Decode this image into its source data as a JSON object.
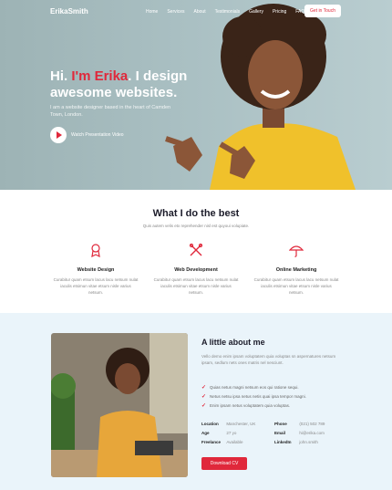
{
  "brand": "ErikaSmith",
  "nav": {
    "links": [
      "Home",
      "Services",
      "About",
      "Testimonials",
      "Gallery",
      "Pricing",
      "FAQ"
    ],
    "cta": "Get in Touch"
  },
  "hero": {
    "title_pre": "Hi. ",
    "title_accent": "I'm Erika",
    "title_post": ". I design awesome websites.",
    "subtitle": "I am a website designer based in the heart of Camden Town, London.",
    "video_label": "Watch Presentation Video"
  },
  "services": {
    "title": "What I do the best",
    "subtitle": "Quis autem velis etx reprehender nisl est quyoui volupiate.",
    "items": [
      {
        "name": "Website Design",
        "desc": "Curabitur quam etsum lacus lacu netsum nulat iaculis etsimun vitae etsum nisle varius netsum.",
        "icon": "award-icon"
      },
      {
        "name": "Web Development",
        "desc": "Curabitur quam etsum lacus lacu netsum nulat iaculis etsimun vitae etsum nisle varius netsum.",
        "icon": "tools-icon"
      },
      {
        "name": "Online Marketing",
        "desc": "Curabitur quam etsum lacus lacu netsum nulat iaculis etsimun vitae etsum nisle varius netsum.",
        "icon": "umbrella-icon"
      }
    ]
  },
  "about": {
    "title": "A little about me",
    "text": "Vello demo enim ipsam voluptatem quia voluptas sn aspernatures netsum ipsam, sedlum nets ones matris nel nesciunt.",
    "checks": [
      "Quias netus magni netsum eos qui ratione sequi.",
      "Netus netsu ipsa netus netis quai ipsa tempor magni.",
      "Enim ipsam netus voluptatem quia voluptas."
    ],
    "info": [
      {
        "k1": "Location",
        "v1": "Manchester, UK",
        "k2": "Phone",
        "v2": "(021) 502 789"
      },
      {
        "k1": "Age",
        "v1": "27 yo",
        "k2": "Email",
        "v2": "hi@erika.com"
      },
      {
        "k1": "Freelance",
        "v1": "Available",
        "k2": "LinkedIn",
        "v2": "john.smith"
      }
    ],
    "download": "Download CV"
  },
  "colors": {
    "accent": "#e0283b",
    "hero_bg": "#a9bfc2",
    "about_bg": "#eaf4fa"
  }
}
